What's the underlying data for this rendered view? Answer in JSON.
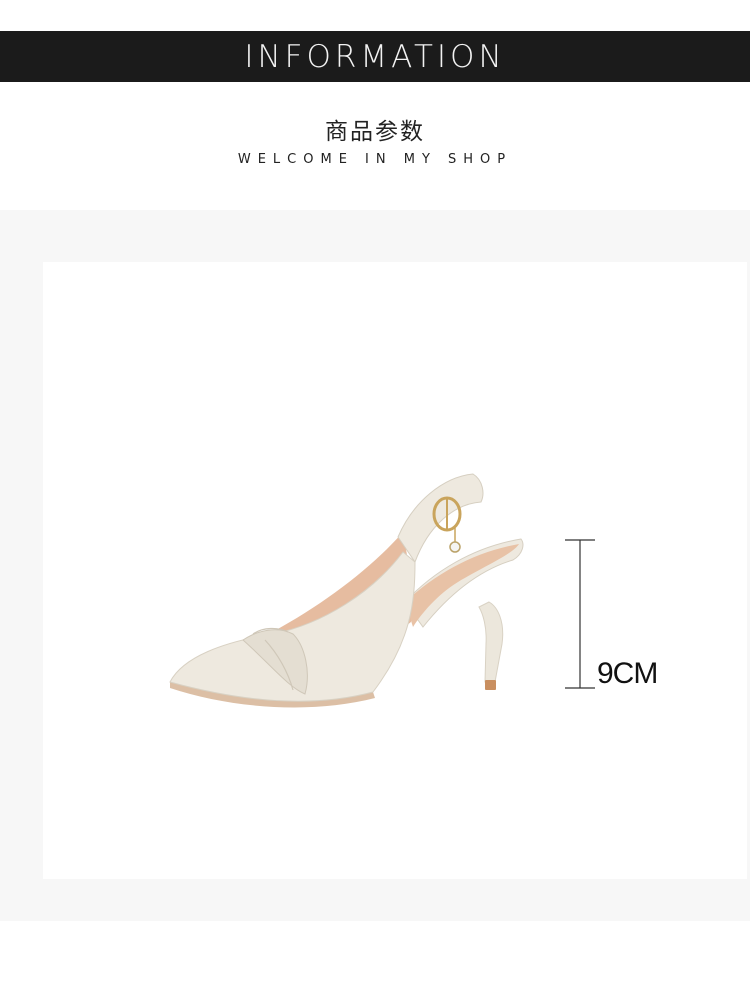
{
  "header": {
    "banner_title": "INFORMATION",
    "cn_title": "商品参数",
    "subtitle": "WELCOME IN MY SHOP"
  },
  "product": {
    "height_label": "9CM"
  },
  "colors": {
    "banner_bg": "#1b1b1b",
    "stage_bg": "#f7f7f7",
    "shoe_upper": "#eee9df",
    "shoe_lining": "#e6bca0",
    "heel_tip": "#c98f60"
  }
}
